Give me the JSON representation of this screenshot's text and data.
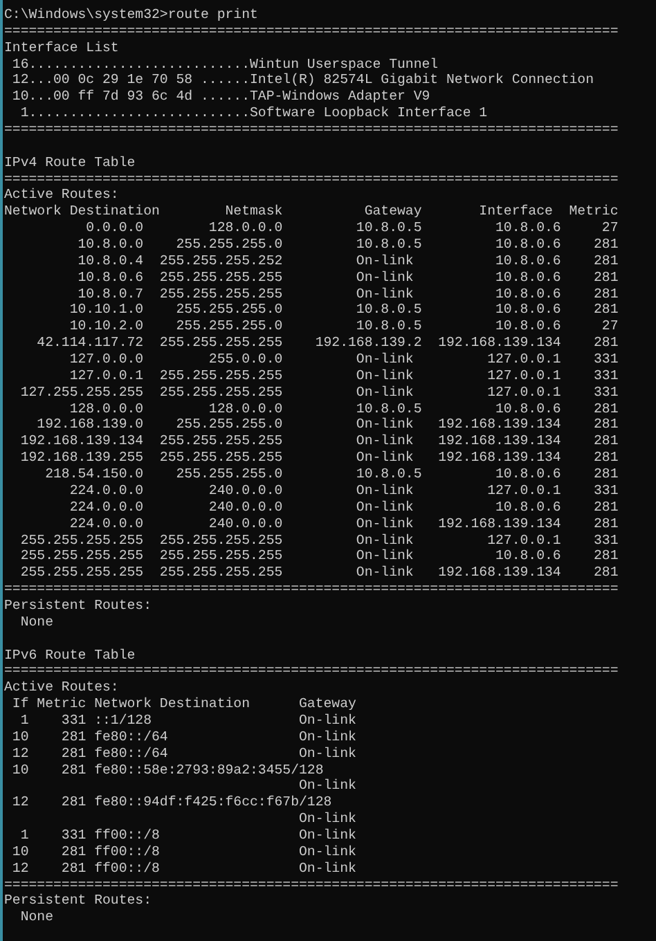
{
  "console": {
    "lines": [
      {
        "kind": "text",
        "text": "C:\\Windows\\system32>route print"
      },
      {
        "kind": "rule",
        "text": "==========================================================================="
      },
      {
        "kind": "text",
        "text": "Interface List"
      },
      {
        "kind": "text",
        "text": " 16...........................Wintun Userspace Tunnel"
      },
      {
        "kind": "text",
        "text": " 12...00 0c 29 1e 70 58 ......Intel(R) 82574L Gigabit Network Connection"
      },
      {
        "kind": "text",
        "text": " 10...00 ff 7d 93 6c 4d ......TAP-Windows Adapter V9"
      },
      {
        "kind": "text",
        "text": "  1...........................Software Loopback Interface 1"
      },
      {
        "kind": "rule",
        "text": "==========================================================================="
      },
      {
        "kind": "blank"
      },
      {
        "kind": "text",
        "text": "IPv4 Route Table"
      },
      {
        "kind": "rule",
        "text": "==========================================================================="
      },
      {
        "kind": "text",
        "text": "Active Routes:"
      },
      {
        "kind": "text",
        "text": "Network Destination        Netmask          Gateway       Interface  Metric"
      },
      {
        "kind": "text",
        "text": "          0.0.0.0        128.0.0.0         10.8.0.5         10.8.0.6     27"
      },
      {
        "kind": "text",
        "text": "         10.8.0.0    255.255.255.0         10.8.0.5         10.8.0.6    281"
      },
      {
        "kind": "text",
        "text": "         10.8.0.4  255.255.255.252         On-link          10.8.0.6    281"
      },
      {
        "kind": "text",
        "text": "         10.8.0.6  255.255.255.255         On-link          10.8.0.6    281"
      },
      {
        "kind": "text",
        "text": "         10.8.0.7  255.255.255.255         On-link          10.8.0.6    281"
      },
      {
        "kind": "text",
        "text": "        10.10.1.0    255.255.255.0         10.8.0.5         10.8.0.6    281"
      },
      {
        "kind": "text",
        "text": "        10.10.2.0    255.255.255.0         10.8.0.5         10.8.0.6     27"
      },
      {
        "kind": "text",
        "text": "    42.114.117.72  255.255.255.255    192.168.139.2  192.168.139.134    281"
      },
      {
        "kind": "text",
        "text": "        127.0.0.0        255.0.0.0         On-link         127.0.0.1    331"
      },
      {
        "kind": "text",
        "text": "        127.0.0.1  255.255.255.255         On-link         127.0.0.1    331"
      },
      {
        "kind": "text",
        "text": "  127.255.255.255  255.255.255.255         On-link         127.0.0.1    331"
      },
      {
        "kind": "text",
        "text": "        128.0.0.0        128.0.0.0         10.8.0.5         10.8.0.6    281"
      },
      {
        "kind": "text",
        "text": "    192.168.139.0    255.255.255.0         On-link   192.168.139.134    281"
      },
      {
        "kind": "text",
        "text": "  192.168.139.134  255.255.255.255         On-link   192.168.139.134    281"
      },
      {
        "kind": "text",
        "text": "  192.168.139.255  255.255.255.255         On-link   192.168.139.134    281"
      },
      {
        "kind": "text",
        "text": "     218.54.150.0    255.255.255.0         10.8.0.5         10.8.0.6    281"
      },
      {
        "kind": "text",
        "text": "        224.0.0.0        240.0.0.0         On-link         127.0.0.1    331"
      },
      {
        "kind": "text",
        "text": "        224.0.0.0        240.0.0.0         On-link          10.8.0.6    281"
      },
      {
        "kind": "text",
        "text": "        224.0.0.0        240.0.0.0         On-link   192.168.139.134    281"
      },
      {
        "kind": "text",
        "text": "  255.255.255.255  255.255.255.255         On-link         127.0.0.1    331"
      },
      {
        "kind": "text",
        "text": "  255.255.255.255  255.255.255.255         On-link          10.8.0.6    281"
      },
      {
        "kind": "text",
        "text": "  255.255.255.255  255.255.255.255         On-link   192.168.139.134    281"
      },
      {
        "kind": "rule",
        "text": "==========================================================================="
      },
      {
        "kind": "text",
        "text": "Persistent Routes:"
      },
      {
        "kind": "text",
        "text": "  None"
      },
      {
        "kind": "blank"
      },
      {
        "kind": "text",
        "text": "IPv6 Route Table"
      },
      {
        "kind": "rule",
        "text": "==========================================================================="
      },
      {
        "kind": "text",
        "text": "Active Routes:"
      },
      {
        "kind": "text",
        "text": " If Metric Network Destination      Gateway"
      },
      {
        "kind": "text",
        "text": "  1    331 ::1/128                  On-link"
      },
      {
        "kind": "text",
        "text": " 10    281 fe80::/64                On-link"
      },
      {
        "kind": "text",
        "text": " 12    281 fe80::/64                On-link"
      },
      {
        "kind": "text",
        "text": " 10    281 fe80::58e:2793:89a2:3455/128"
      },
      {
        "kind": "text",
        "text": "                                    On-link"
      },
      {
        "kind": "text",
        "text": " 12    281 fe80::94df:f425:f6cc:f67b/128"
      },
      {
        "kind": "text",
        "text": "                                    On-link"
      },
      {
        "kind": "text",
        "text": "  1    331 ff00::/8                 On-link"
      },
      {
        "kind": "text",
        "text": " 10    281 ff00::/8                 On-link"
      },
      {
        "kind": "text",
        "text": " 12    281 ff00::/8                 On-link"
      },
      {
        "kind": "rule",
        "text": "==========================================================================="
      },
      {
        "kind": "text",
        "text": "Persistent Routes:"
      },
      {
        "kind": "text",
        "text": "  None"
      }
    ]
  }
}
